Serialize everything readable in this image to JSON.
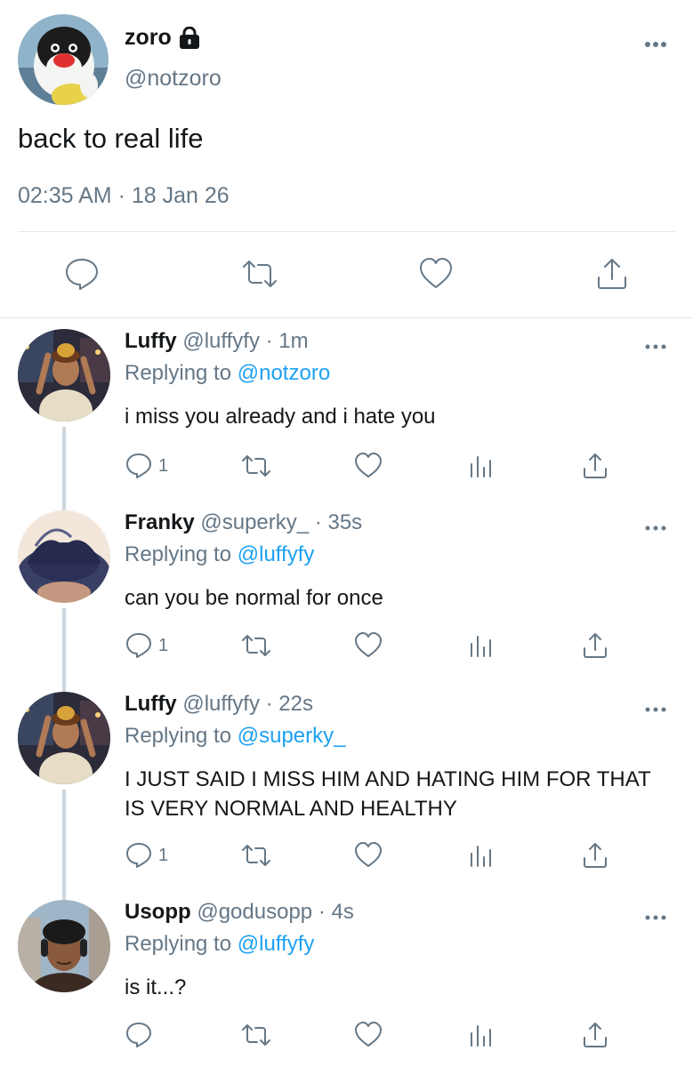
{
  "main_tweet": {
    "name": "zoro",
    "handle": "@notzoro",
    "text": "back to real life",
    "timestamp": "02:35 AM · 18 Jan 26",
    "locked_icon": "lock-icon"
  },
  "replies": [
    {
      "name": "Luffy",
      "handle": "@luffyfy",
      "dot": "·",
      "time": "1m",
      "replying_label": "Replying to",
      "mention": "@notzoro",
      "text": "i miss you already and i hate you",
      "reply_count": "1"
    },
    {
      "name": "Franky",
      "handle": "@superky_",
      "dot": "·",
      "time": "35s",
      "replying_label": "Replying to",
      "mention": "@luffyfy",
      "text": "can you be normal for once",
      "reply_count": "1"
    },
    {
      "name": "Luffy",
      "handle": "@luffyfy",
      "dot": "·",
      "time": "22s",
      "replying_label": "Replying to",
      "mention": "@superky_",
      "text": "I JUST SAID I MISS HIM AND HATING HIM FOR THAT IS VERY NORMAL AND HEALTHY",
      "reply_count": "1"
    },
    {
      "name": "Usopp",
      "handle": "@godusopp",
      "dot": "·",
      "time": "4s",
      "replying_label": "Replying to",
      "mention": "@luffyfy",
      "text": "is it...?",
      "reply_count": ""
    }
  ],
  "colors": {
    "link": "#1da1f2",
    "secondary_text": "#657786",
    "divider": "#e1e8ed",
    "thread_line": "#ccd6dd"
  }
}
